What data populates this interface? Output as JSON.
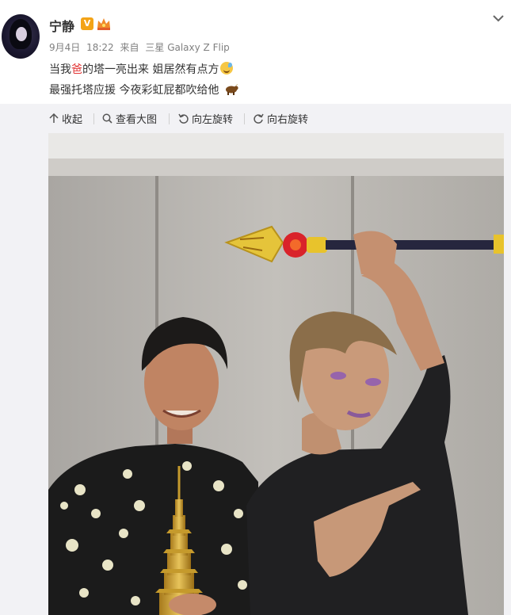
{
  "user": {
    "name": "宁静",
    "verified_badge": "V",
    "crown_icon": "crown-icon"
  },
  "meta": {
    "date": "9月4日",
    "time": "18:22",
    "source_prefix": "来自",
    "device": "三星 Galaxy Z Flip"
  },
  "post": {
    "line1_a": "当我",
    "line1_red": "爸",
    "line1_b": "的塔一亮出来 姐居然有点方",
    "line2": "最强托塔应援 今夜彩虹屁都吹给他"
  },
  "actions": {
    "collapse": "收起",
    "view_large": "查看大图",
    "rotate_left": "向左旋转",
    "rotate_right": "向右旋转"
  },
  "colors": {
    "accent_red": "#e23333",
    "meta_gray": "#808080",
    "toolbar_bg": "#f2f2f5",
    "badge_orange": "#f3a316"
  }
}
